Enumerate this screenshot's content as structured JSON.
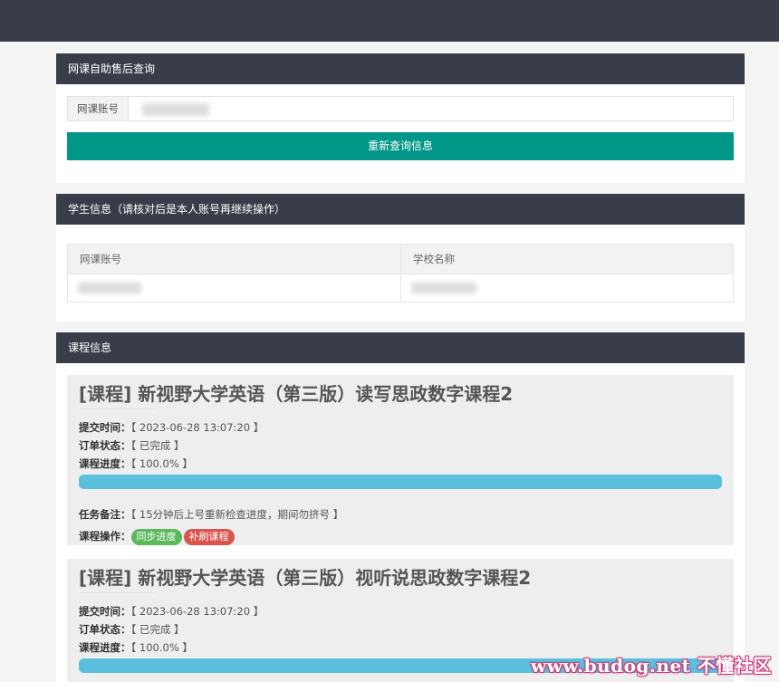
{
  "query_panel": {
    "title": "网课自助售后查询",
    "account_label": "网课账号",
    "account_value": "",
    "refresh_label": "重新查询信息"
  },
  "student_panel": {
    "title": "学生信息（请核对后是本人账号再继续操作）",
    "columns": [
      "网课账号",
      "学校名称"
    ],
    "values": [
      "",
      ""
    ]
  },
  "course_panel": {
    "title": "课程信息",
    "courses": [
      {
        "title": "[课程] 新视野大学英语（第三版）读写思政数字课程2",
        "submit_label": "提交时间：",
        "submit_value": "【 2023-06-28 13:07:20 】",
        "status_label": "订单状态：",
        "status_value": "【 已完成 】",
        "progress_label": "课程进度：",
        "progress_value": "【 100.0% 】",
        "progress_pct": 100,
        "note_label": "任务备注：",
        "note_value": "【 15分钟后上号重新检查进度，期间勿挤号 】",
        "ops_label": "课程操作：",
        "sync_label": "同步进度",
        "redo_label": "补刷课程"
      },
      {
        "title": "[课程] 新视野大学英语（第三版）视听说思政数字课程2",
        "submit_label": "提交时间：",
        "submit_value": "【 2023-06-28 13:07:20 】",
        "status_label": "订单状态：",
        "status_value": "【 已完成 】",
        "progress_label": "课程进度：",
        "progress_value": "【 100.0% 】",
        "progress_pct": 100
      }
    ]
  },
  "watermark": "www.budog.net 不懂社区",
  "colors": {
    "header_dark": "#393d49",
    "primary_button": "#009688",
    "progress_bar": "#5bc0de",
    "tag_green": "#5cb85c",
    "tag_red": "#d9534f"
  }
}
